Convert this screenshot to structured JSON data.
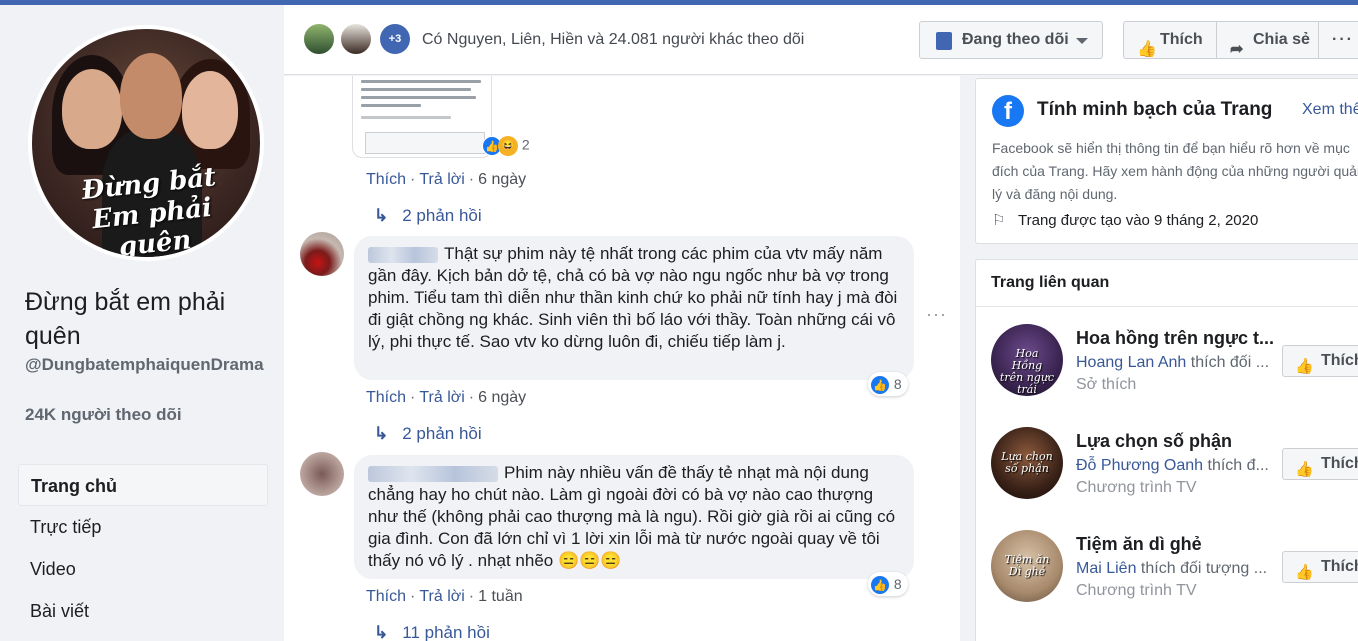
{
  "page": {
    "name": "Đừng bắt em phải quên",
    "handle": "@DungbatemphaiquenDrama",
    "followers": "24K người theo dõi",
    "avatar_text": "Đừng bắt Em phải quên"
  },
  "nav": {
    "items": [
      {
        "label": "Trang chủ",
        "active": true
      },
      {
        "label": "Trực tiếp"
      },
      {
        "label": "Video"
      },
      {
        "label": "Bài viết"
      }
    ]
  },
  "header": {
    "more_count": "+3",
    "follow_text": "Có Nguyen, Liên, Hiền và 24.081 người khác theo dõi",
    "follow_button": "Đang theo dõi",
    "like_button": "Thích",
    "share_button": "Chia sẻ",
    "more_button": "···"
  },
  "feed": {
    "top_comment": {
      "reaction_count": "2",
      "actions": {
        "like": "Thích",
        "reply": "Trả lời",
        "time": "6 ngày"
      },
      "replies": "2 phản hồi"
    },
    "comments": [
      {
        "text": "Thật sự phim này tệ nhất trong các phim của vtv mấy năm gần đây. Kịch bản dở tệ, chả có bà vợ nào ngu ngốc như bà vợ trong phim. Tiểu tam thì diễn như thần kinh chứ ko phải nữ tính hay j mà đòi đi giật chồng ng khác. Sinh viên thì bố láo với thầy. Toàn những cái vô lý, phi thực tế. Sao vtv ko dừng luôn đi, chiếu tiếp làm j.",
        "reaction_count": "8",
        "actions": {
          "like": "Thích",
          "reply": "Trả lời",
          "time": "6 ngày"
        },
        "replies": "2 phản hồi"
      },
      {
        "text": "Phim này nhiều vấn đề thấy tẻ nhạt mà nội dung chẳng hay ho chút nào. Làm gì ngoài đời có bà vợ nào cao thượng như thế (không phải cao thượng mà là ngu). Rồi giờ già rồi ai cũng có gia đình. Con đã lớn chỉ vì 1 lời xin lỗi mà từ nước ngoài quay về tôi thấy nó vô lý . nhạt nhẽo 😑😑😑",
        "reaction_count": "8",
        "actions": {
          "like": "Thích",
          "reply": "Trả lời",
          "time": "1 tuần"
        },
        "replies": "11 phản hồi"
      }
    ]
  },
  "transparency": {
    "title": "Tính minh bạch của Trang",
    "see_all": "Xem thêm",
    "description": "Facebook sẽ hiển thị thông tin để bạn hiểu rõ hơn về mục đích của Trang. Hãy xem hành động của những người quản lý và đăng nội dung.",
    "created": "Trang được tạo vào 9 tháng 2, 2020"
  },
  "related": {
    "title": "Trang liên quan",
    "items": [
      {
        "name": "Hoa hồng trên ngực t...",
        "who": "Hoang Lan Anh",
        "rest": " thích đối ...",
        "category": "Sở thích",
        "button": "Thích",
        "thumb_text": "Hoa Hồng trên ngực trái"
      },
      {
        "name": "Lựa chọn số phận",
        "who": "Đỗ Phương Oanh",
        "rest": " thích đ...",
        "category": "Chương trình TV",
        "button": "Thích",
        "thumb_text": "Lựa chọn số phận"
      },
      {
        "name": "Tiệm ăn dì ghẻ",
        "who": "Mai Liên",
        "rest": " thích đối tượng ...",
        "category": "Chương trình TV",
        "button": "Thích",
        "thumb_text": "Tiệm ăn Dì ghẻ"
      }
    ]
  },
  "icons": {
    "like": "thumbs-up-icon",
    "share": "share-arrow-icon",
    "follow": "clipboard-check-icon",
    "facebook": "facebook-logo-icon",
    "flag": "flag-icon",
    "reply": "reply-arrow-icon"
  },
  "colors": {
    "brand": "#4267b2",
    "link": "#385898",
    "like_blue": "#1877f2"
  }
}
